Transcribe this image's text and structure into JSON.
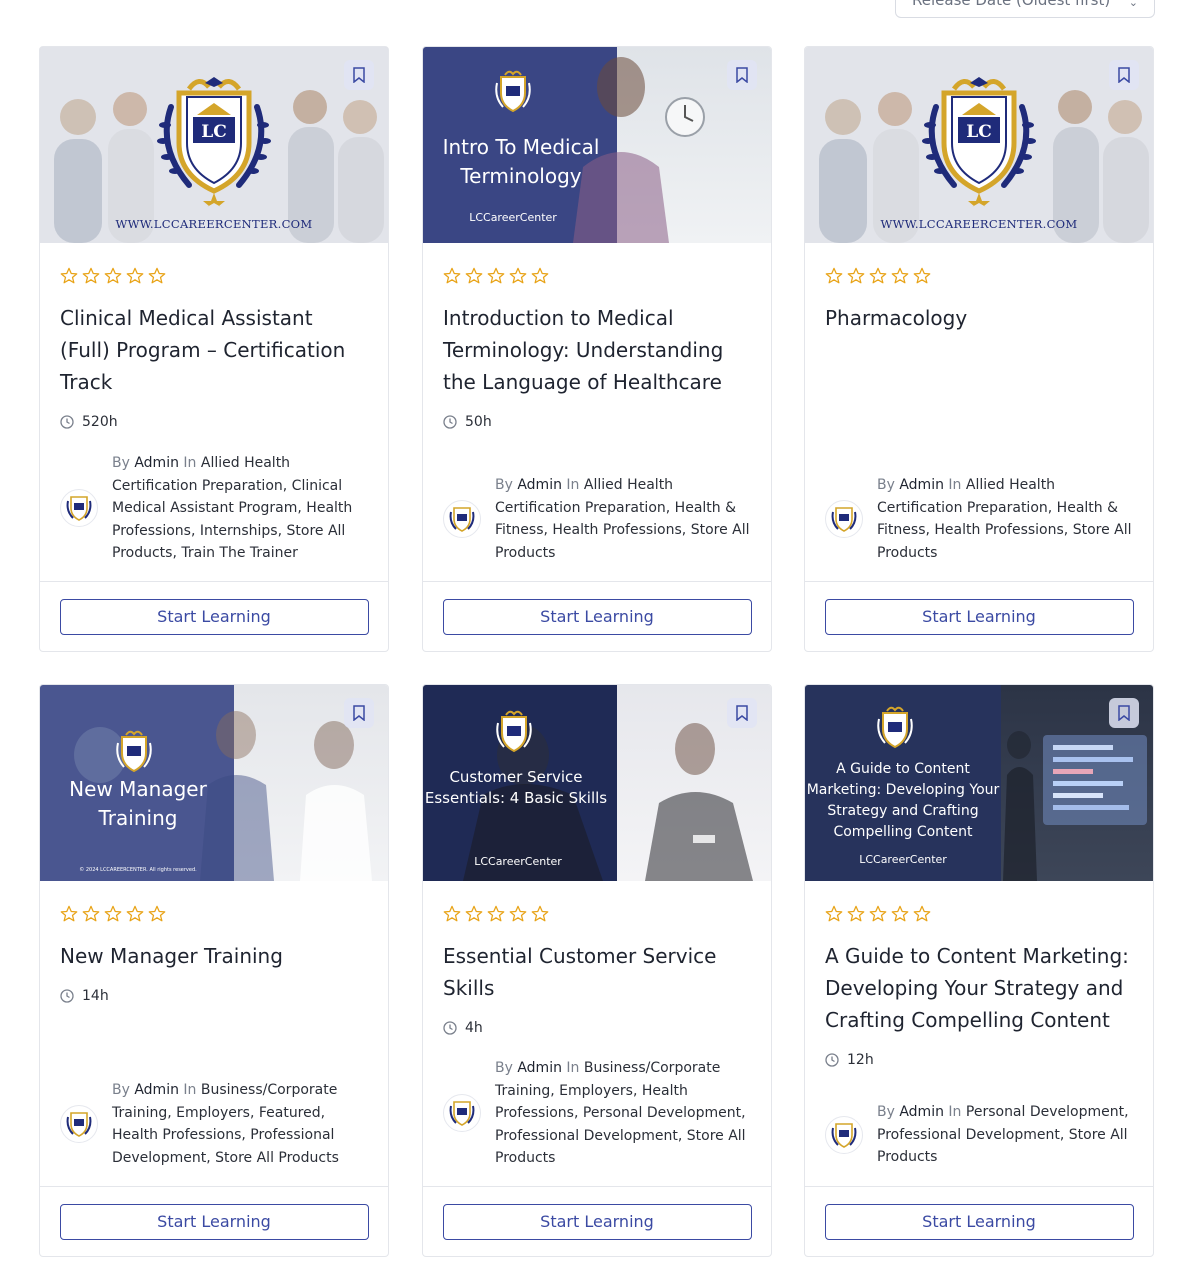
{
  "sort": {
    "label": "Release Date (Oldest first)"
  },
  "courses": [
    {
      "thumb_title": "",
      "thumb_brand": "",
      "thumb_url": "WWW.LCCAREERCENTER.COM",
      "title": "Clinical Medical Assistant (Full) Program – Certification Track",
      "duration": "520h",
      "by": "By",
      "author": "Admin",
      "in": "In",
      "categories": [
        "Allied Health Certification Preparation",
        "Clinical Medical Assistant Program",
        "Health Professions",
        "Internships",
        "Store All Products",
        "Train The Trainer"
      ],
      "button": "Start Learning"
    },
    {
      "thumb_title": "Intro To Medical Terminology",
      "thumb_brand": "LCCareerCenter",
      "thumb_url": "",
      "title": "Introduction to Medical Terminology: Understanding the Language of Healthcare",
      "duration": "50h",
      "by": "By",
      "author": "Admin",
      "in": "In",
      "categories": [
        "Allied Health Certification Preparation",
        "Health & Fitness",
        "Health Professions",
        "Store All Products"
      ],
      "button": "Start Learning"
    },
    {
      "thumb_title": "",
      "thumb_brand": "",
      "thumb_url": "WWW.LCCAREERCENTER.COM",
      "title": "Pharmacology",
      "duration": "",
      "by": "By",
      "author": "Admin",
      "in": "In",
      "categories": [
        "Allied Health Certification Preparation",
        "Health & Fitness",
        "Health Professions",
        "Store All Products"
      ],
      "button": "Start Learning"
    },
    {
      "thumb_title": "New Manager Training",
      "thumb_brand": "© 2024 LCCAREERCENTER. All rights reserved.",
      "thumb_url": "",
      "title": "New Manager Training",
      "duration": "14h",
      "by": "By",
      "author": "Admin",
      "in": "In",
      "categories": [
        "Business/Corporate Training",
        "Employers",
        "Featured",
        "Health Professions",
        "Professional Development",
        "Store All Products"
      ],
      "button": "Start Learning"
    },
    {
      "thumb_title": "Customer Service Essentials: 4 Basic Skills",
      "thumb_brand": "LCCareerCenter",
      "thumb_url": "",
      "title": "Essential Customer Service Skills",
      "duration": "4h",
      "by": "By",
      "author": "Admin",
      "in": "In",
      "categories": [
        "Business/Corporate Training",
        "Employers",
        "Health Professions",
        "Personal Development",
        "Professional Development",
        "Store All Products"
      ],
      "button": "Start Learning"
    },
    {
      "thumb_title": "A Guide to Content Marketing: Developing Your Strategy and Crafting Compelling Content",
      "thumb_brand": "LCCareerCenter",
      "thumb_url": "",
      "title": "A Guide to Content Marketing: Developing Your Strategy and Crafting Compelling Content",
      "duration": "12h",
      "by": "By",
      "author": "Admin",
      "in": "In",
      "categories": [
        "Personal Development",
        "Professional Development",
        "Store All Products"
      ],
      "button": "Start Learning"
    }
  ],
  "colors": {
    "accent": "#3b4aa3",
    "star": "#e8a317",
    "navy": "#1f2b7a",
    "gold": "#d4a52a"
  }
}
